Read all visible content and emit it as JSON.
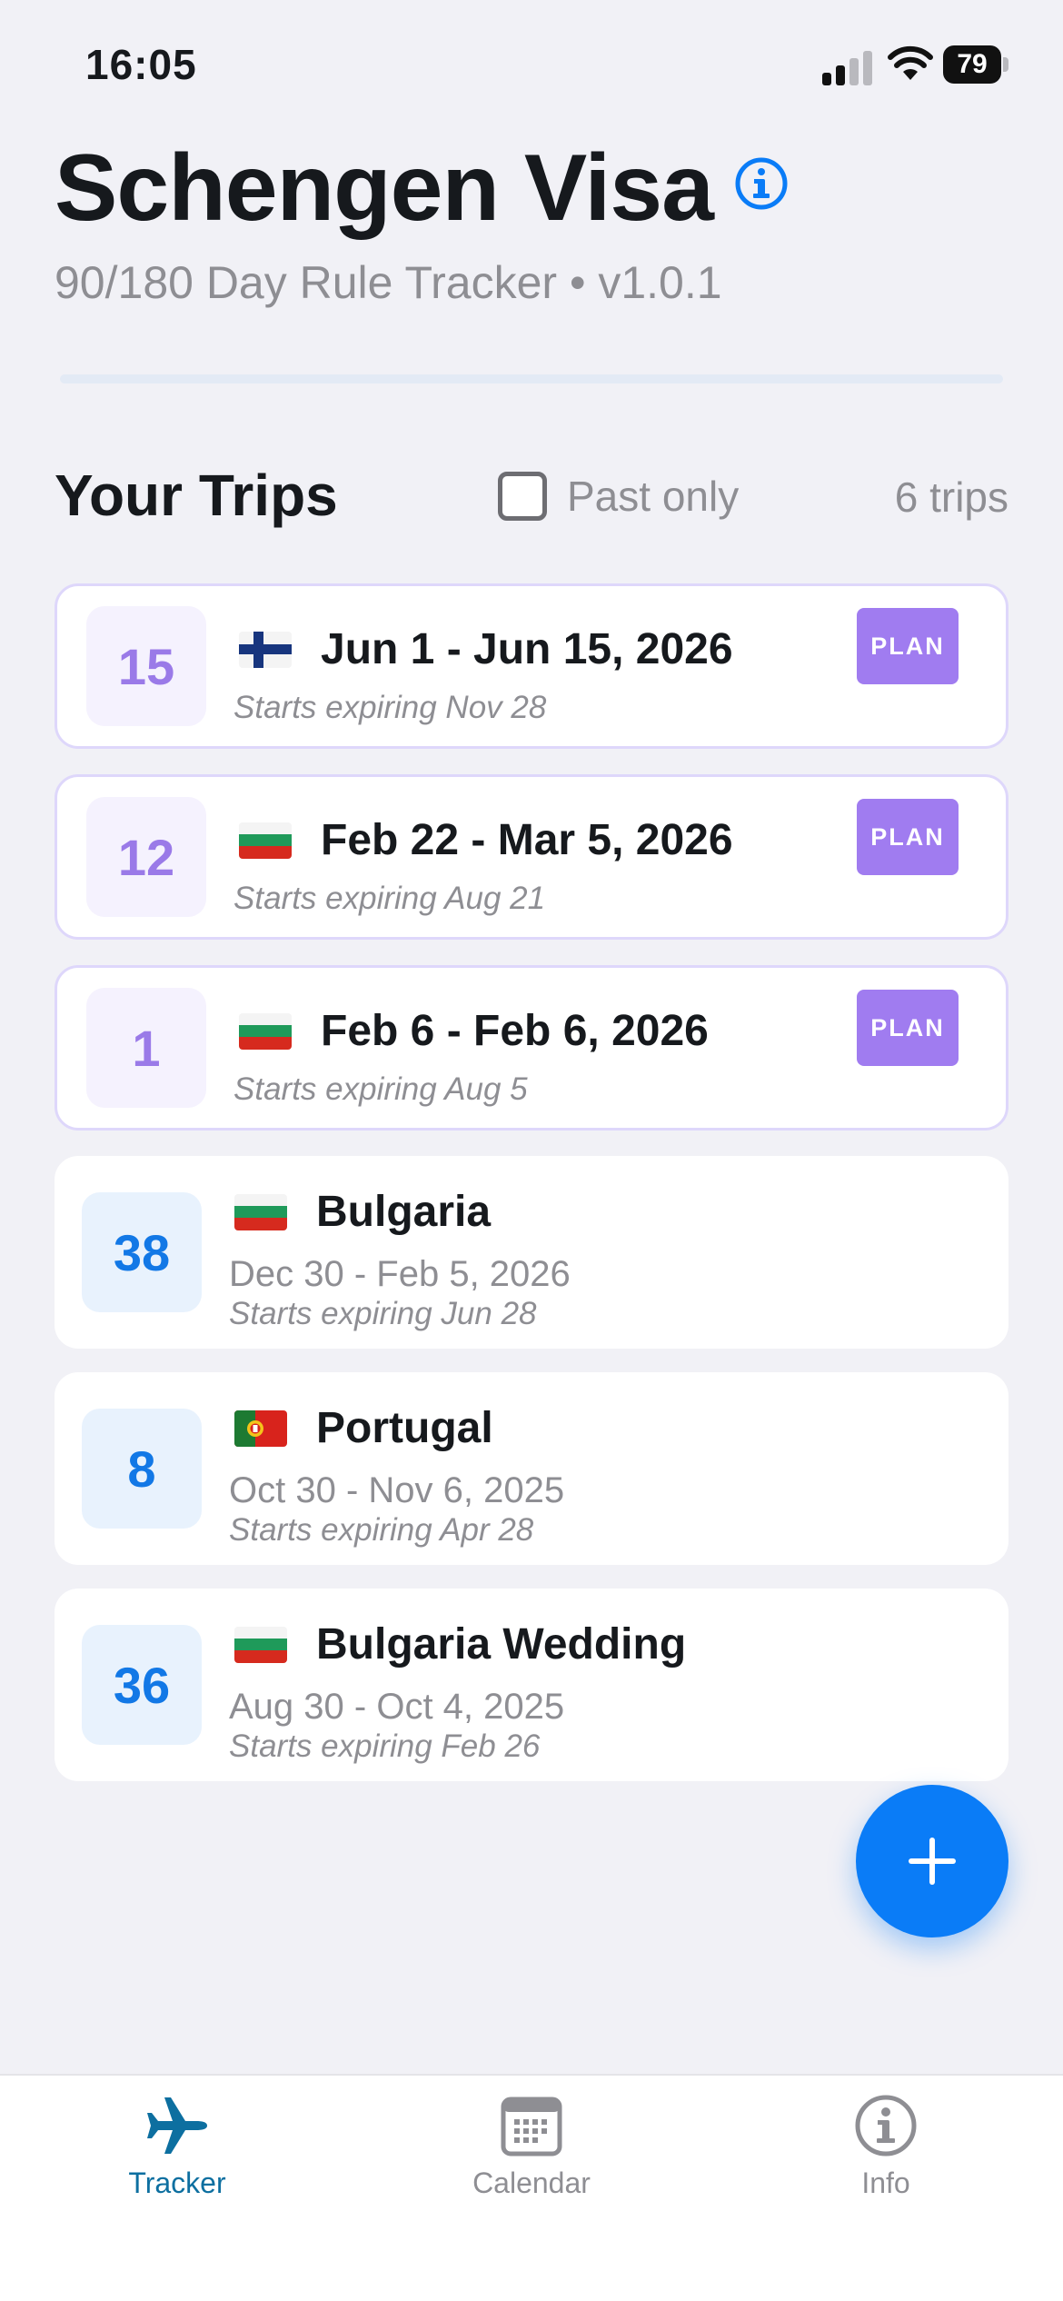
{
  "status_bar": {
    "time": "16:05",
    "battery": "79"
  },
  "header": {
    "title": "Schengen Visa",
    "subtitle": "90/180 Day Rule Tracker • v1.0.1"
  },
  "trips_section": {
    "title": "Your Trips",
    "filter_label": "Past only",
    "count": "6 trips"
  },
  "trips": [
    {
      "kind": "planned",
      "days": "15",
      "flag": "finland",
      "title": "Jun 1 - Jun 15, 2026",
      "expiry": "Starts expiring Nov 28",
      "badge": "PLAN"
    },
    {
      "kind": "planned",
      "days": "12",
      "flag": "bulgaria",
      "title": "Feb 22 - Mar 5, 2026",
      "expiry": "Starts expiring Aug 21",
      "badge": "PLAN"
    },
    {
      "kind": "planned",
      "days": "1",
      "flag": "bulgaria",
      "title": "Feb 6 - Feb 6, 2026",
      "expiry": "Starts expiring Aug 5",
      "badge": "PLAN"
    },
    {
      "kind": "past",
      "days": "38",
      "flag": "bulgaria",
      "title": "Bulgaria",
      "dates": "Dec 30 - Feb 5, 2026",
      "expiry": "Starts expiring Jun 28"
    },
    {
      "kind": "past",
      "days": "8",
      "flag": "portugal",
      "title": "Portugal",
      "dates": "Oct 30 - Nov 6, 2025",
      "expiry": "Starts expiring Apr 28"
    },
    {
      "kind": "past",
      "days": "36",
      "flag": "bulgaria",
      "title": "Bulgaria Wedding",
      "dates": "Aug 30 - Oct 4, 2025",
      "expiry": "Starts expiring Feb 26"
    }
  ],
  "tabs": [
    {
      "label": "Tracker",
      "icon": "airplane-icon",
      "active": true
    },
    {
      "label": "Calendar",
      "icon": "calendar-icon",
      "active": false
    },
    {
      "label": "Info",
      "icon": "info-icon",
      "active": false
    }
  ],
  "colors": {
    "accent_blue": "#0a7cf7",
    "plan_purple": "#a07cf0",
    "planned_day_text": "#9a7ae8",
    "past_day_text": "#1278e6",
    "active_tab": "#0d6fa0"
  }
}
